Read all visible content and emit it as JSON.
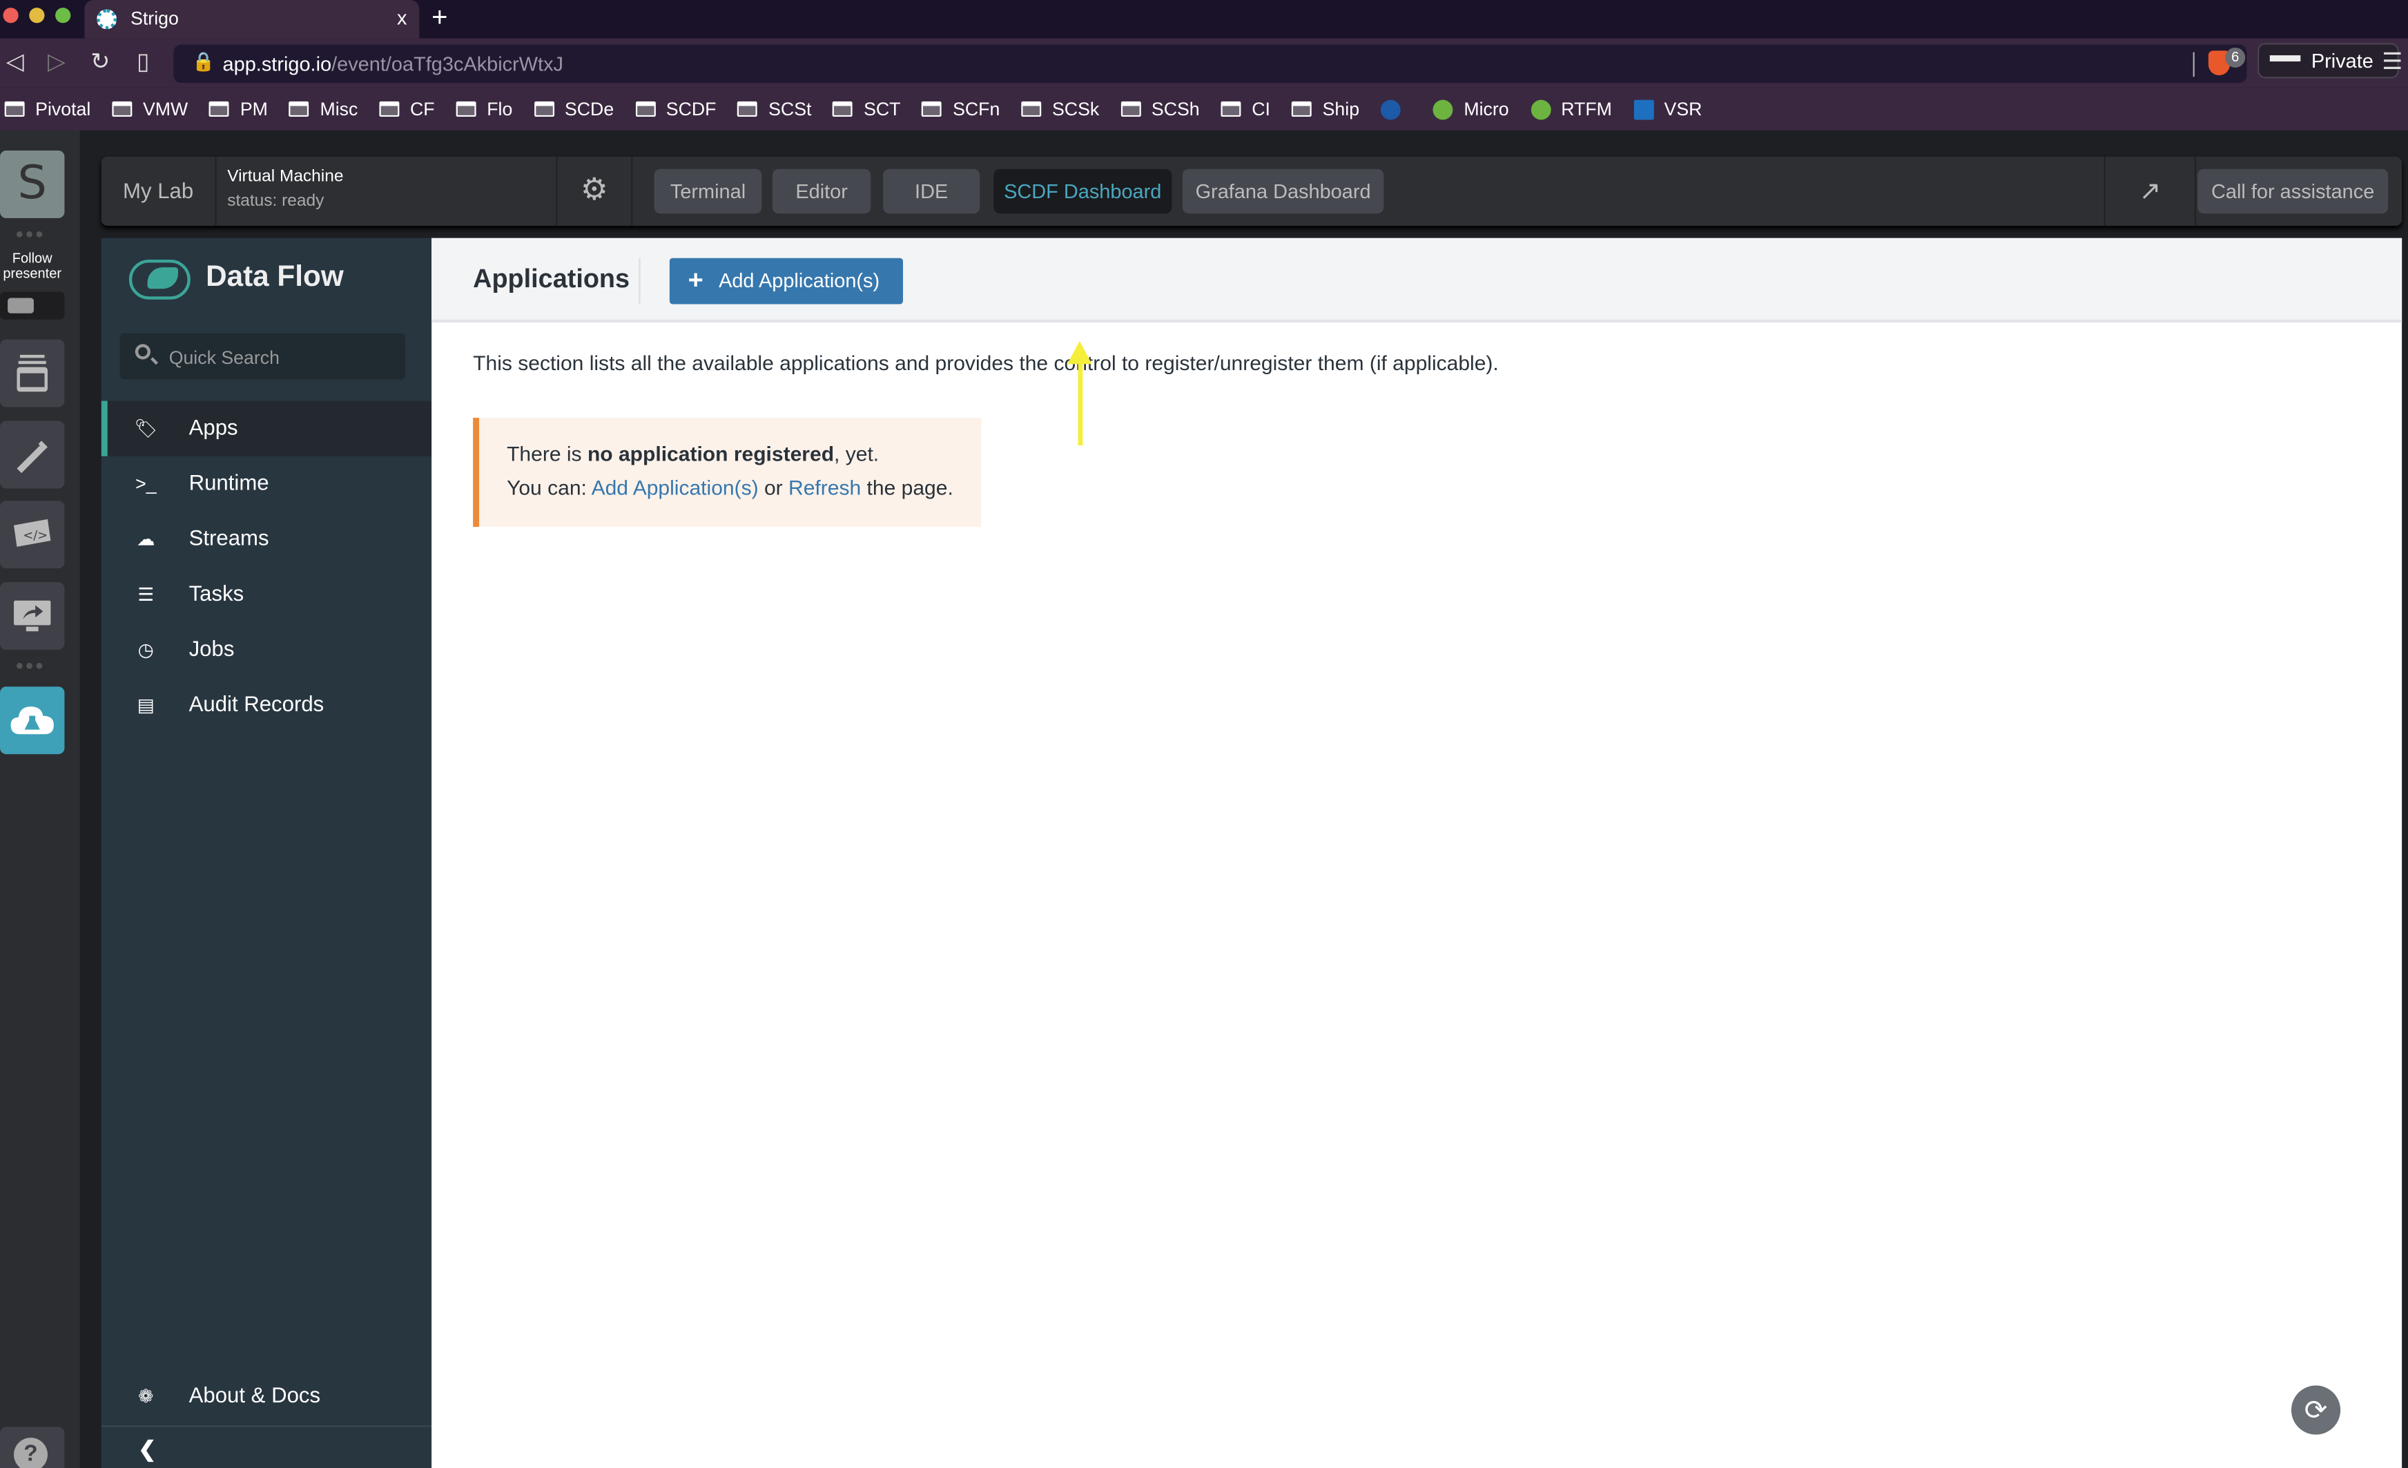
{
  "browser": {
    "tab_title": "Strigo",
    "tab_close": "x",
    "new_tab": "+",
    "url_domain": "app.strigo.io",
    "url_path": "/event/oaTfg3cAkbicrWtxJ",
    "shields_count": "6",
    "private_label": "Private",
    "bookmarks": [
      {
        "label": "Pivotal",
        "icon": "folder-icon"
      },
      {
        "label": "VMW",
        "icon": "folder-icon"
      },
      {
        "label": "PM",
        "icon": "folder-icon"
      },
      {
        "label": "Misc",
        "icon": "folder-icon"
      },
      {
        "label": "CF",
        "icon": "folder-icon"
      },
      {
        "label": "Flo",
        "icon": "folder-icon"
      },
      {
        "label": "SCDe",
        "icon": "folder-icon"
      },
      {
        "label": "SCDF",
        "icon": "folder-icon"
      },
      {
        "label": "SCSt",
        "icon": "folder-icon"
      },
      {
        "label": "SCT",
        "icon": "folder-icon"
      },
      {
        "label": "SCFn",
        "icon": "folder-icon"
      },
      {
        "label": "SCSk",
        "icon": "folder-icon"
      },
      {
        "label": "SCSh",
        "icon": "folder-icon"
      },
      {
        "label": "CI",
        "icon": "folder-icon"
      },
      {
        "label": "Ship",
        "icon": "folder-icon"
      },
      {
        "label": "",
        "icon": "clock-favicon",
        "color": "#1d5aa8"
      },
      {
        "label": "Micro",
        "icon": "spring-favicon",
        "color": "#6db33f"
      },
      {
        "label": "RTFM",
        "icon": "leaf-favicon",
        "color": "#6db33f"
      },
      {
        "label": "VSR",
        "icon": "vmw-favicon",
        "color": "#1d6fc0"
      }
    ]
  },
  "rail": {
    "avatar_letter": "S",
    "follow_label": "Follow presenter",
    "help": "?"
  },
  "lab": {
    "my_lab": "My Lab",
    "vm_title": "Virtual Machine",
    "vm_status": "status: ready",
    "tabs": [
      {
        "label": "Terminal",
        "active": false
      },
      {
        "label": "Editor",
        "active": false
      },
      {
        "label": "IDE",
        "active": false
      },
      {
        "label": "SCDF Dashboard",
        "active": true
      },
      {
        "label": "Grafana Dashboard",
        "active": false
      }
    ],
    "assist_label": "Call for assistance"
  },
  "sidebar": {
    "brand": "Data Flow",
    "search_placeholder": "Quick Search",
    "items": [
      {
        "label": "Apps",
        "icon": "tags-icon",
        "active": true
      },
      {
        "label": "Runtime",
        "icon": "terminal-icon",
        "active": false
      },
      {
        "label": "Streams",
        "icon": "cloud-icon",
        "active": false
      },
      {
        "label": "Tasks",
        "icon": "server-icon",
        "active": false
      },
      {
        "label": "Jobs",
        "icon": "clock-icon",
        "active": false
      },
      {
        "label": "Audit Records",
        "icon": "list-icon",
        "active": false
      }
    ],
    "about": "About & Docs",
    "accent": "#3ba597"
  },
  "main": {
    "title": "Applications",
    "add_button": "Add Application(s)",
    "description": "This section lists all the available applications and provides the control to register/unregister them (if applicable).",
    "alert": {
      "l1_pre": "There is ",
      "l1_bold": "no application registered",
      "l1_post": ", yet.",
      "l2_pre": "You can: ",
      "l2_link1": "Add Application(s)",
      "l2_mid": " or ",
      "l2_link2": "Refresh",
      "l2_post": " the page."
    },
    "accent": "#3677ae",
    "alert_border": "#ec8a3a"
  }
}
